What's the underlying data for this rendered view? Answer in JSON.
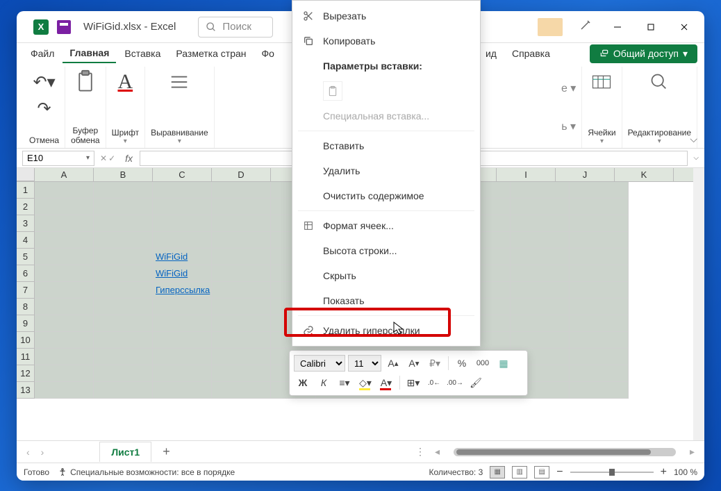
{
  "title": "WiFiGid.xlsx - Excel",
  "search_placeholder": "Поиск",
  "tabs": [
    "Файл",
    "Главная",
    "Вставка",
    "Разметка стран",
    "Фо",
    "ид",
    "Справка"
  ],
  "active_tab": "Главная",
  "share_label": "Общий доступ",
  "ribbon_groups": {
    "undo": "Отмена",
    "clipboard": "Буфер\nобмена",
    "font": "Шрифт",
    "align": "Выравнивание",
    "cells": "Ячейки",
    "editing": "Редактирование"
  },
  "name_box": "E10",
  "columns": [
    "A",
    "B",
    "C",
    "D",
    "I",
    "J",
    "K"
  ],
  "rows_count": 13,
  "cells": {
    "C5": {
      "text": "WiFiGid",
      "link": true
    },
    "C6": {
      "text": "WiFiGid",
      "link": true
    },
    "C7": {
      "text": "Гиперссылка",
      "link": true
    }
  },
  "sheet_name": "Лист1",
  "status": {
    "ready": "Готово",
    "accessibility": "Специальные возможности: все в порядке",
    "count": "Количество: 3",
    "zoom": "100 %"
  },
  "context_menu": {
    "cut": "Вырезать",
    "copy": "Копировать",
    "paste_options_header": "Параметры вставки:",
    "paste_special": "Специальная вставка...",
    "insert": "Вставить",
    "delete": "Удалить",
    "clear": "Очистить содержимое",
    "format_cells": "Формат ячеек...",
    "row_height": "Высота строки...",
    "hide": "Скрыть",
    "show": "Показать",
    "remove_links": "Удалить гиперссылки"
  },
  "mini_toolbar": {
    "font": "Calibri",
    "size": "11",
    "percent": "%",
    "bold": "Ж",
    "italic": "К"
  }
}
